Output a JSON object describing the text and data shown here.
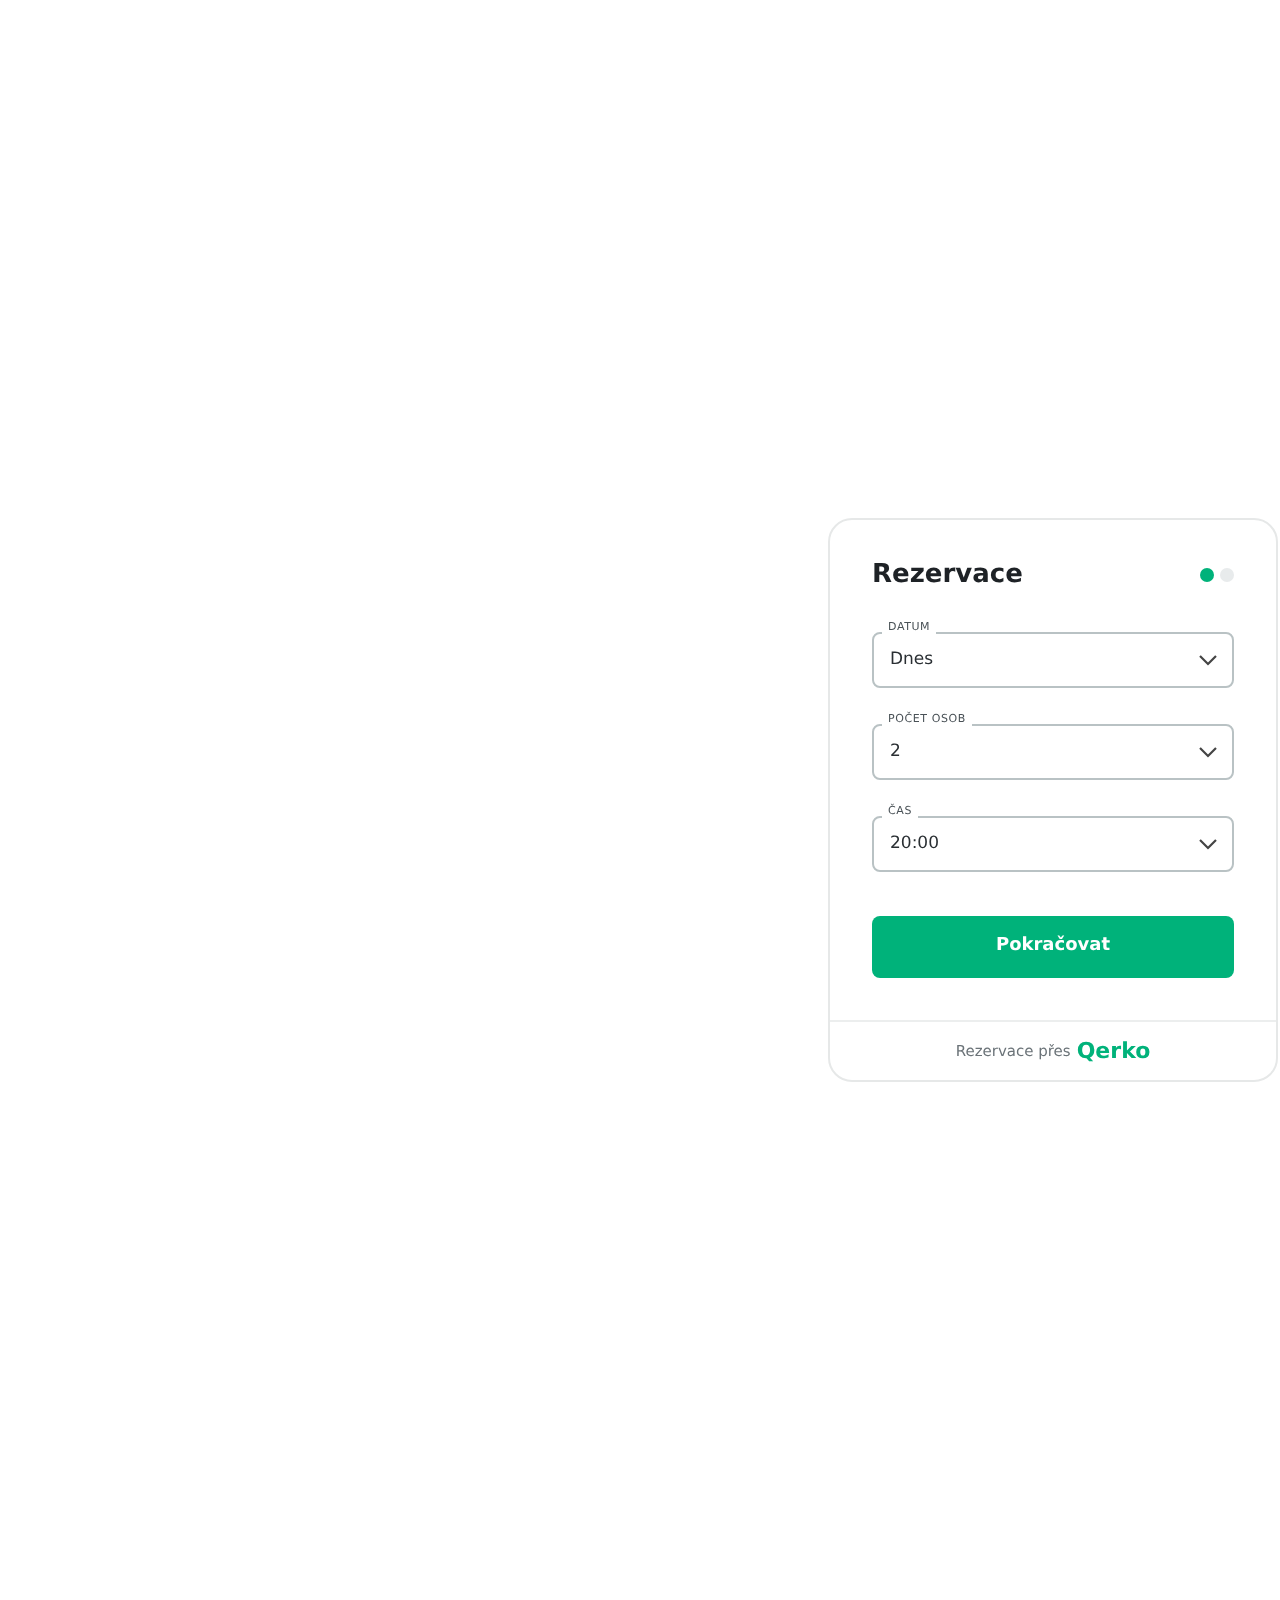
{
  "title": "Rezervace",
  "steps": [
    {
      "selected": true
    },
    {
      "selected": false
    }
  ],
  "fields": [
    {
      "label": "DATUM",
      "value": "Dnes"
    },
    {
      "label": "POČET OSOB",
      "value": "2"
    },
    {
      "label": "ČAS",
      "value": "20:00"
    }
  ],
  "button": "Pokračovat",
  "footer": {
    "text": "Rezervace přes",
    "brand": "Qerko"
  }
}
